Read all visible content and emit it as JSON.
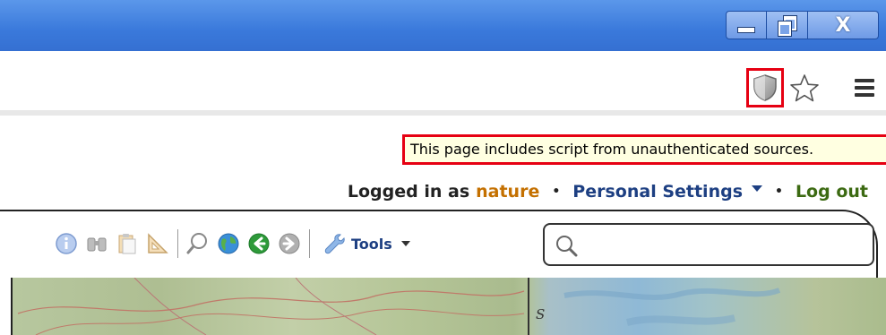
{
  "window": {
    "controls": {
      "minimize_icon": "minimize-icon",
      "restore_icon": "restore-icon",
      "close_label": "X"
    },
    "titlebar_color": "#3a79db"
  },
  "omnibar": {
    "security_icon": "shield-icon",
    "bookmark_icon": "star-icon",
    "menu_icon": "hamburger-menu-icon",
    "highlight_color": "#e60012"
  },
  "page": {
    "warning_text": "This page includes script from unauthenticated sources.",
    "userbar": {
      "logged_in_prefix": "Logged in as",
      "username": "nature",
      "separator": "•",
      "personal_settings": "Personal Settings",
      "logout": "Log out"
    },
    "map_toolbar": {
      "tools_label": "Tools",
      "search_placeholder": "",
      "icons": [
        "info-icon",
        "binoculars-icon",
        "clipboard-icon",
        "ruler-triangle-icon",
        "zoom-icon",
        "globe-icon",
        "back-arrow-icon",
        "forward-arrow-icon",
        "wrench-icon"
      ]
    },
    "map_label": "S"
  }
}
